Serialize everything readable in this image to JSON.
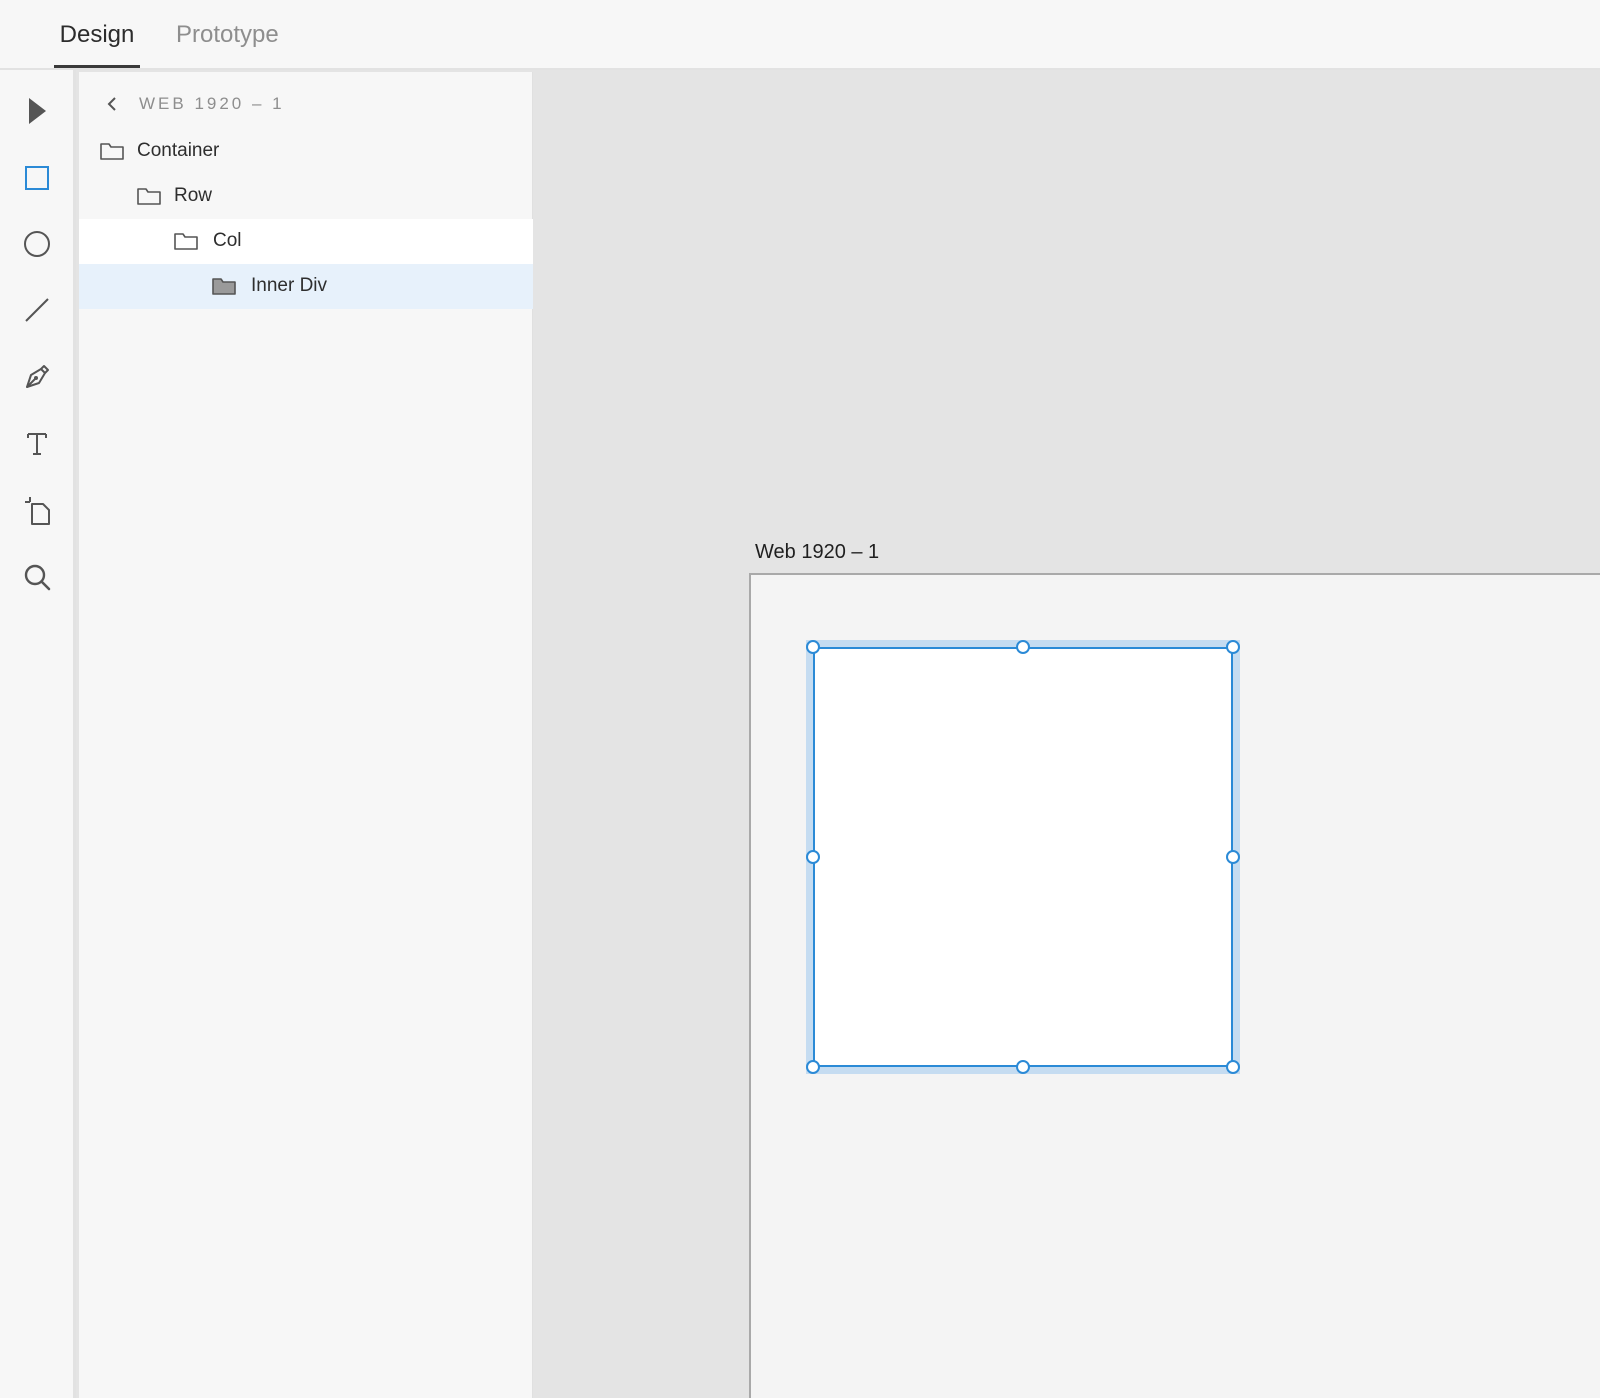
{
  "tabs": {
    "design": "Design",
    "prototype": "Prototype"
  },
  "toolbar": {
    "tools": [
      {
        "name": "select",
        "icon": "arrow-pointer-icon"
      },
      {
        "name": "rectangle",
        "icon": "rectangle-icon",
        "active": true
      },
      {
        "name": "ellipse",
        "icon": "ellipse-icon"
      },
      {
        "name": "line",
        "icon": "line-icon"
      },
      {
        "name": "pen",
        "icon": "pen-icon"
      },
      {
        "name": "text",
        "icon": "text-icon"
      },
      {
        "name": "artboard",
        "icon": "artboard-icon"
      },
      {
        "name": "zoom",
        "icon": "magnifier-icon"
      }
    ]
  },
  "layers": {
    "breadcrumb": "WEB 1920 – 1",
    "items": [
      {
        "label": "Container",
        "icon": "folder-icon"
      },
      {
        "label": "Row",
        "icon": "folder-icon"
      },
      {
        "label": "Col",
        "icon": "folder-icon",
        "hovered": true
      },
      {
        "label": "Inner Div",
        "icon": "folder-filled-icon",
        "selected": true
      }
    ]
  },
  "canvas": {
    "artboard_title": "Web 1920 – 1"
  },
  "colors": {
    "accent": "#2b8ad6",
    "selection_halo": "#c5dcf1",
    "selected_row": "#e7f1fb",
    "panel_bg": "#f7f7f7",
    "canvas_bg": "#e4e4e4"
  }
}
